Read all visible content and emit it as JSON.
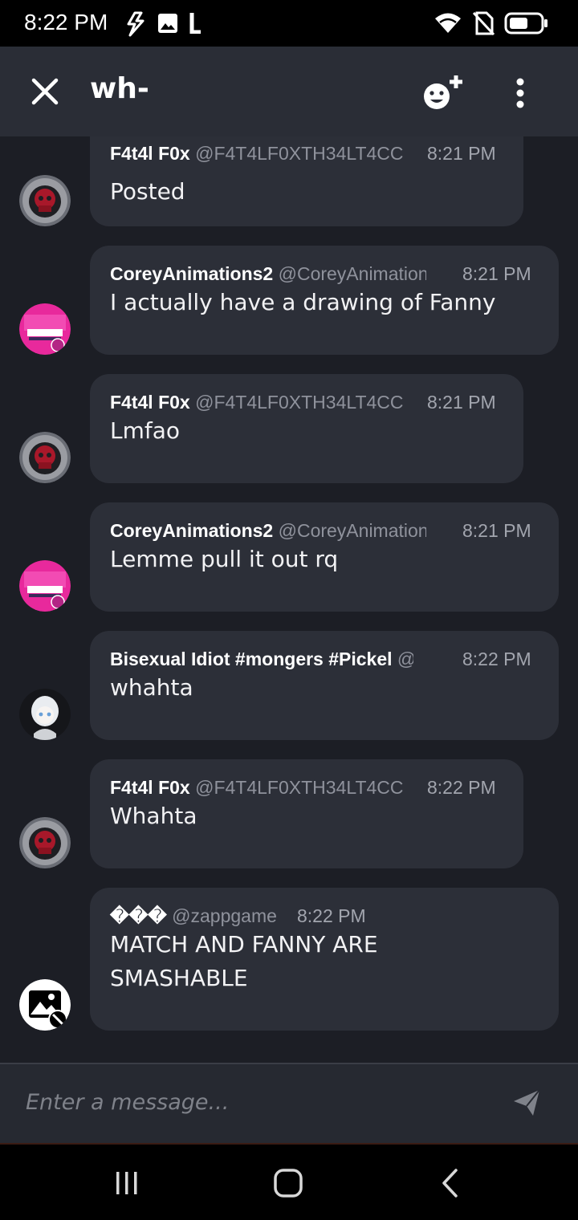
{
  "status_bar": {
    "time": "8:22 PM",
    "icons": [
      "flash-icon",
      "image-icon",
      "l-icon",
      "wifi-icon",
      "no-sim-icon",
      "battery-icon"
    ]
  },
  "header": {
    "title": "wh-",
    "icons": [
      "close-icon",
      "add-emoji-icon",
      "more-vertical-icon"
    ]
  },
  "messages": [
    {
      "author": "F4t4l F0x",
      "handle": "@F4T4LF0XTH34LT4CC",
      "time": "8:21 PM",
      "lines": [
        "Posted"
      ],
      "avatar": "skull-red-avatar"
    },
    {
      "author": "CoreyAnimations2",
      "handle": "@CoreyAnimation",
      "time": "8:21 PM",
      "lines": [
        "I actually have a drawing of Fanny"
      ],
      "avatar": "pink-helmet-avatar"
    },
    {
      "author": "F4t4l F0x",
      "handle": "@F4T4LF0XTH34LT4CC",
      "time": "8:21 PM",
      "lines": [
        "Lmfao"
      ],
      "avatar": "skull-red-avatar"
    },
    {
      "author": "CoreyAnimations2",
      "handle": "@CoreyAnimation",
      "time": "8:21 PM",
      "lines": [
        "Lemme pull it out rq"
      ],
      "avatar": "pink-helmet-avatar"
    },
    {
      "author": "Bisexual Idiot #mongers #Pickel",
      "handle": "@",
      "time": "8:22 PM",
      "lines": [
        "whahta"
      ],
      "avatar": "white-hair-avatar"
    },
    {
      "author": "F4t4l F0x",
      "handle": "@F4T4LF0XTH34LT4CC",
      "time": "8:22 PM",
      "lines": [
        "Whahta"
      ],
      "avatar": "skull-red-avatar"
    },
    {
      "author": "���",
      "handle": "@zappgame",
      "time": "8:22 PM",
      "lines": [
        "MATCH AND FANNY ARE",
        "SMASHABLE"
      ],
      "avatar": "broken-image-avatar"
    }
  ],
  "composer": {
    "placeholder": "Enter a message..."
  },
  "nav_bar": {
    "icons": [
      "recent-apps-icon",
      "home-icon",
      "back-icon"
    ]
  },
  "colors": {
    "header_bg": "#2a2d36",
    "message_area_bg": "#1c1e25",
    "bubble_bg": "#2c2f38",
    "handle_color": "#8f929c",
    "time_color": "#a2a5ae",
    "avatar_pink": "#e8299c"
  }
}
